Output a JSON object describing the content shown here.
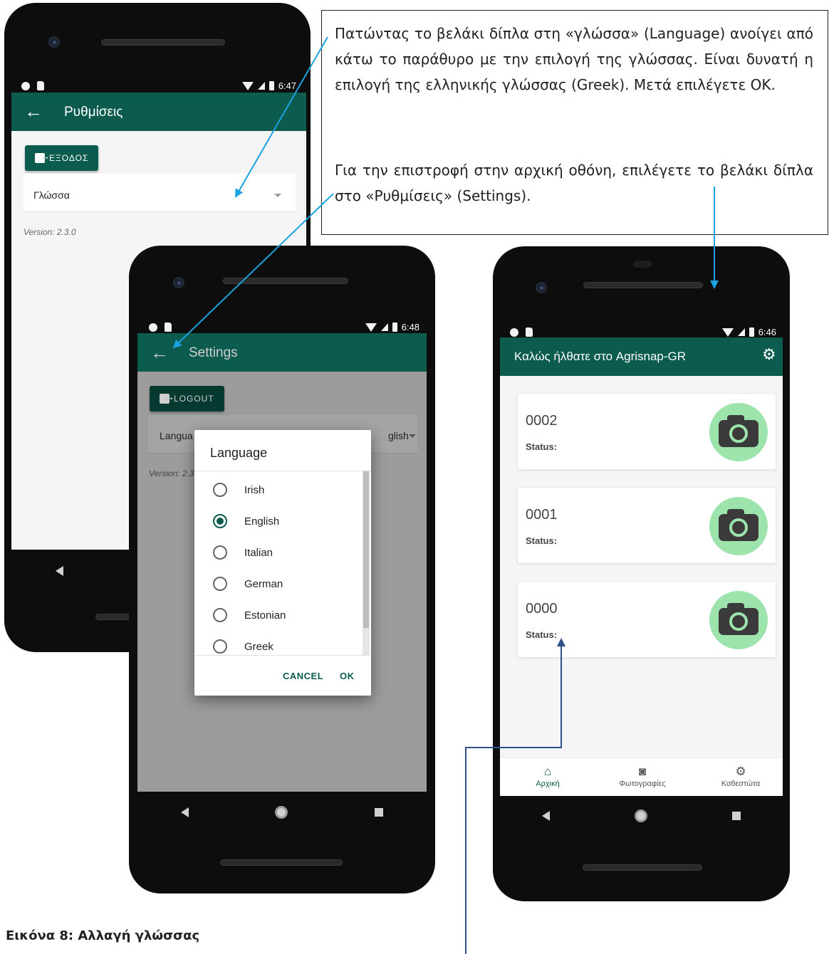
{
  "colors": {
    "primary": "#0b5b4e",
    "camera_bg": "#9de3ac",
    "arrow_light": "#1aa3e0",
    "arrow_dark": "#2d4f8a"
  },
  "phone_greek": {
    "time": "6:47",
    "title": "Ρυθμίσεις",
    "back_icon": "arrow-left-icon",
    "exit_label": "ΕΞΟΔΟΣ",
    "language_label": "Γλώσσα",
    "version": "Version: 2.3.0"
  },
  "phone_settings": {
    "time": "6:48",
    "title": "Settings",
    "logout_label": "LOGOUT",
    "language_label_partial": "Langua",
    "language_value_partial": "glish",
    "version_partial": "Version: 2.3",
    "dialog": {
      "title": "Language",
      "options": [
        {
          "label": "Irish",
          "checked": false
        },
        {
          "label": "English",
          "checked": true
        },
        {
          "label": "Italian",
          "checked": false
        },
        {
          "label": "German",
          "checked": false
        },
        {
          "label": "Estonian",
          "checked": false
        },
        {
          "label": "Greek",
          "checked": false
        }
      ],
      "cancel": "CANCEL",
      "ok": "OK"
    }
  },
  "phone_home": {
    "time": "6:46",
    "title": "Καλώς ήλθατε στο Agrisnap-GR",
    "settings_icon": "gear-icon",
    "cards": [
      {
        "id": "0002",
        "status": "Status:"
      },
      {
        "id": "0001",
        "status": "Status:"
      },
      {
        "id": "0000",
        "status": "Status:"
      }
    ],
    "tabs": [
      {
        "label": "Αρχική",
        "icon": "home-icon"
      },
      {
        "label": "Φωτογραφίες",
        "icon": "camera-icon"
      },
      {
        "label": "Καθεστώτα",
        "icon": "gear-icon"
      }
    ]
  },
  "callout": {
    "paragraph1": "Πατώντας το βελάκι δίπλα στη «γλώσσα» (Language) ανοίγει από κάτω το παράθυρο με την επιλογή της γλώσσας. Είναι δυνατή η επιλογή της ελληνικής γλώσσας (Greek). Μετά επιλέγετε ΟΚ.",
    "paragraph2": "Για την επιστροφή  στην αρχική οθόνη, επιλέγετε το βελάκι δίπλα στο «Ρυθμίσεις» (Settings)."
  },
  "caption": "Εικόνα 8: Αλλαγή γλώσσας"
}
